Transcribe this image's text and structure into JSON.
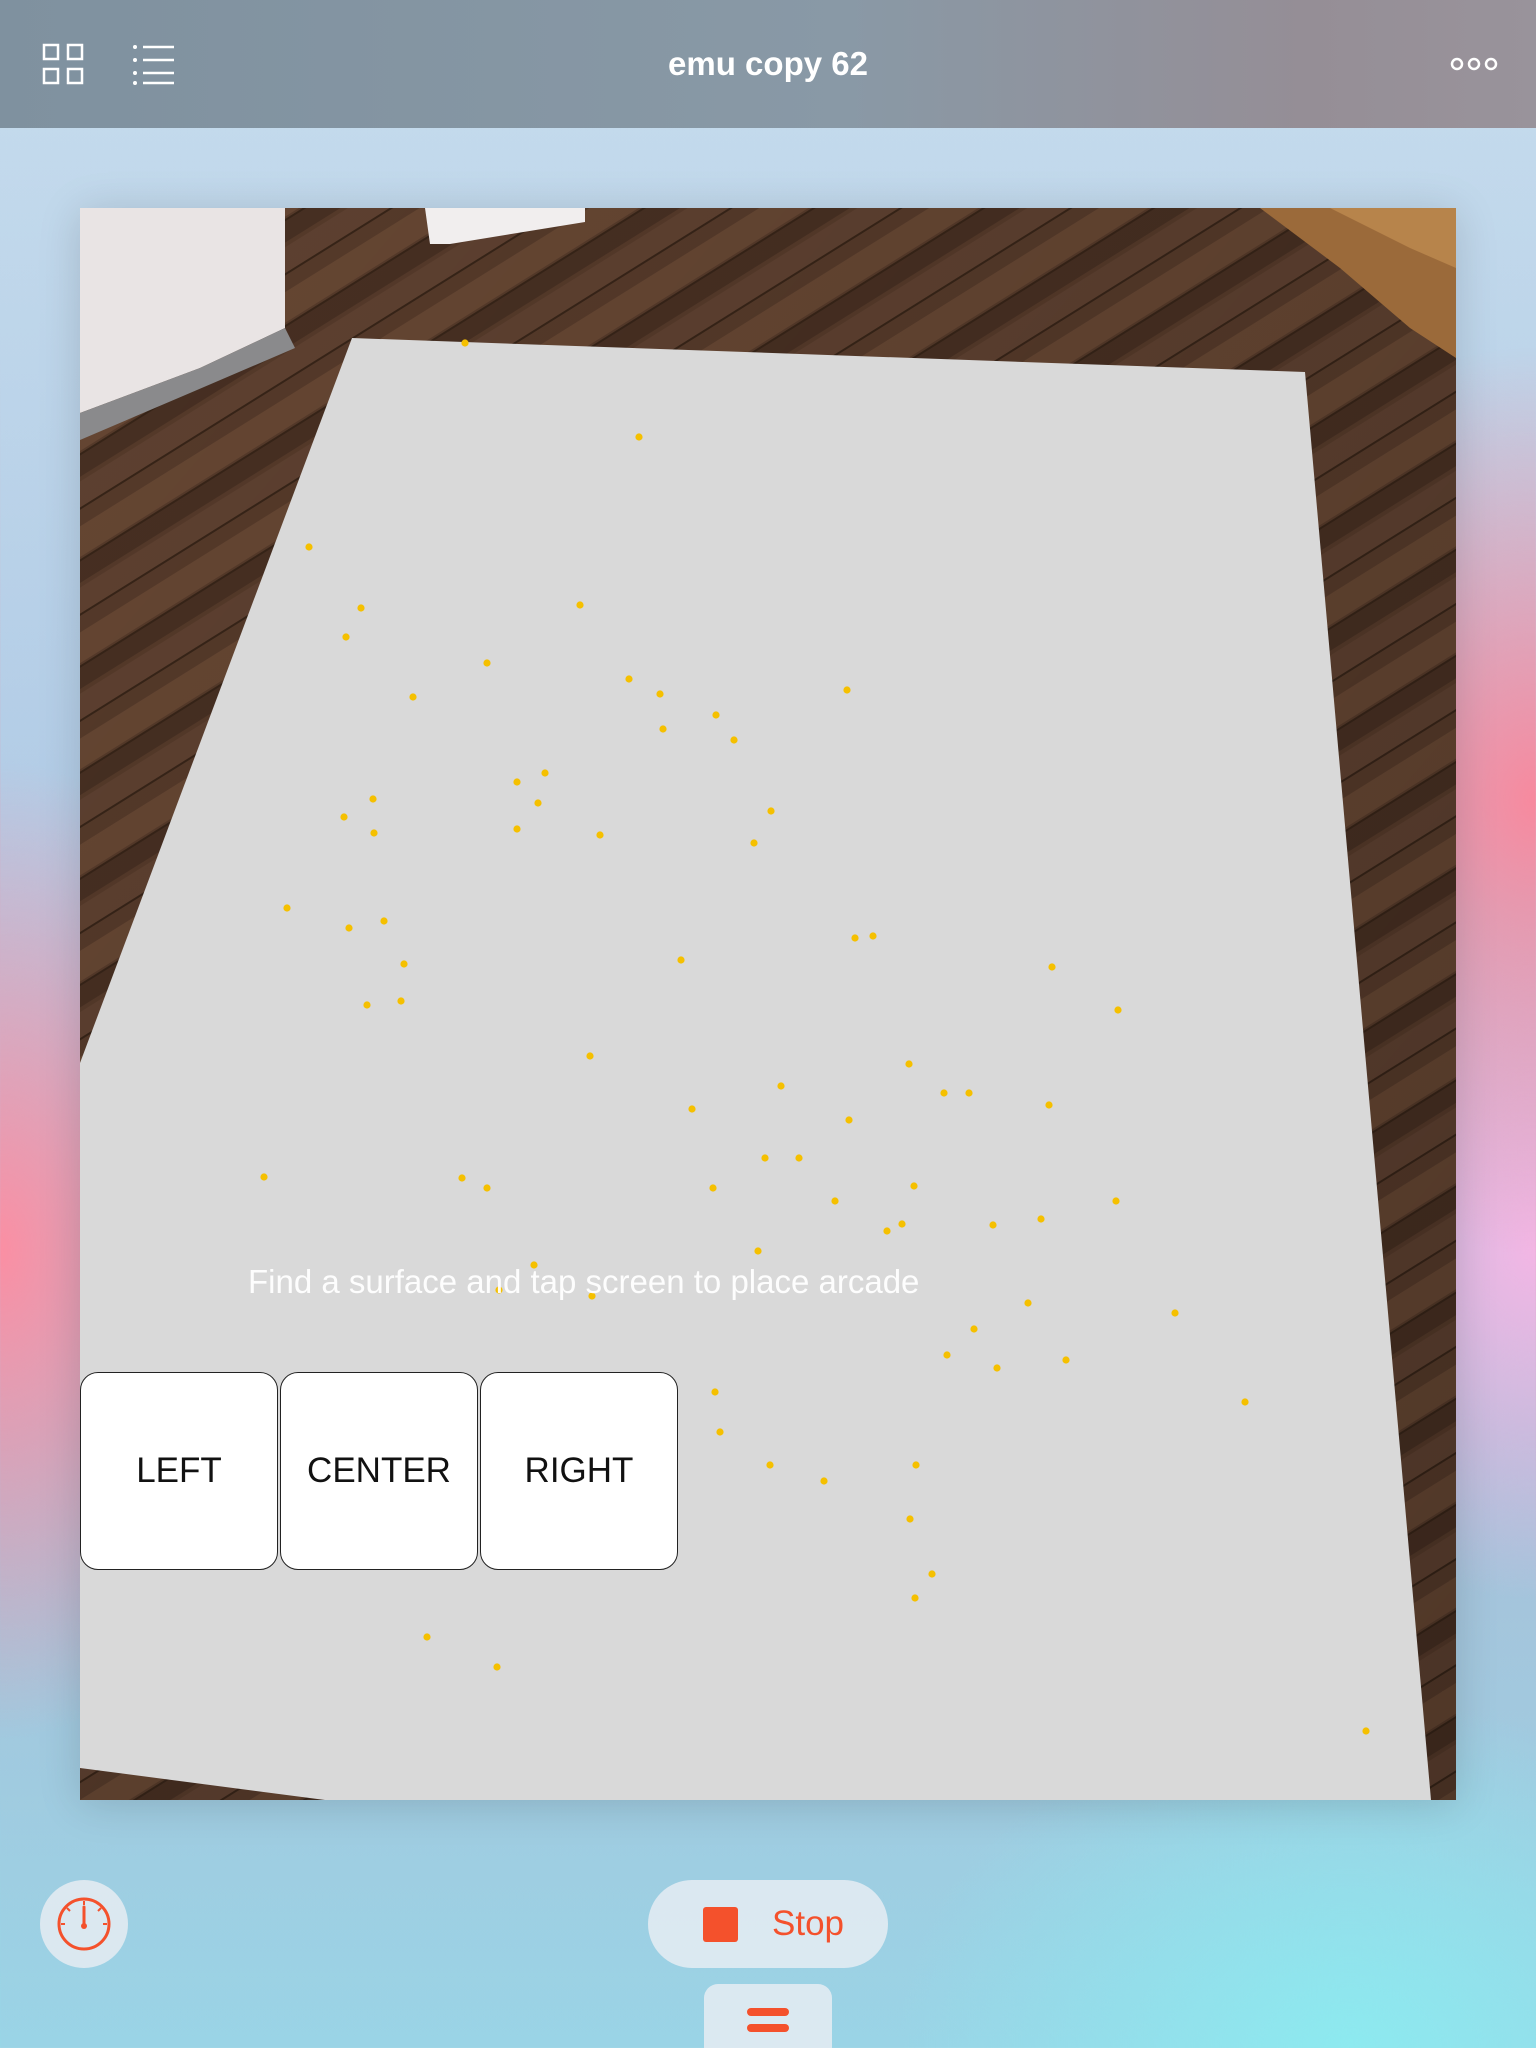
{
  "header": {
    "title": "emu copy 62",
    "grid_icon": "grid-view-icon",
    "list_icon": "list-view-icon",
    "more_icon": "more-options-icon"
  },
  "canvas": {
    "hint_text": "Find a surface and tap screen to place arcade",
    "buttons": {
      "left": "LEFT",
      "center": "CENTER",
      "right": "RIGHT"
    },
    "plane_color": "#d9d9d9",
    "feature_point_color": "#f5c000"
  },
  "footer": {
    "gauge_icon": "speedometer-icon",
    "stop_label": "Stop",
    "stop_icon": "stop-square-icon",
    "handle_icon": "drag-handle-icon",
    "accent_color": "#f4512c"
  }
}
